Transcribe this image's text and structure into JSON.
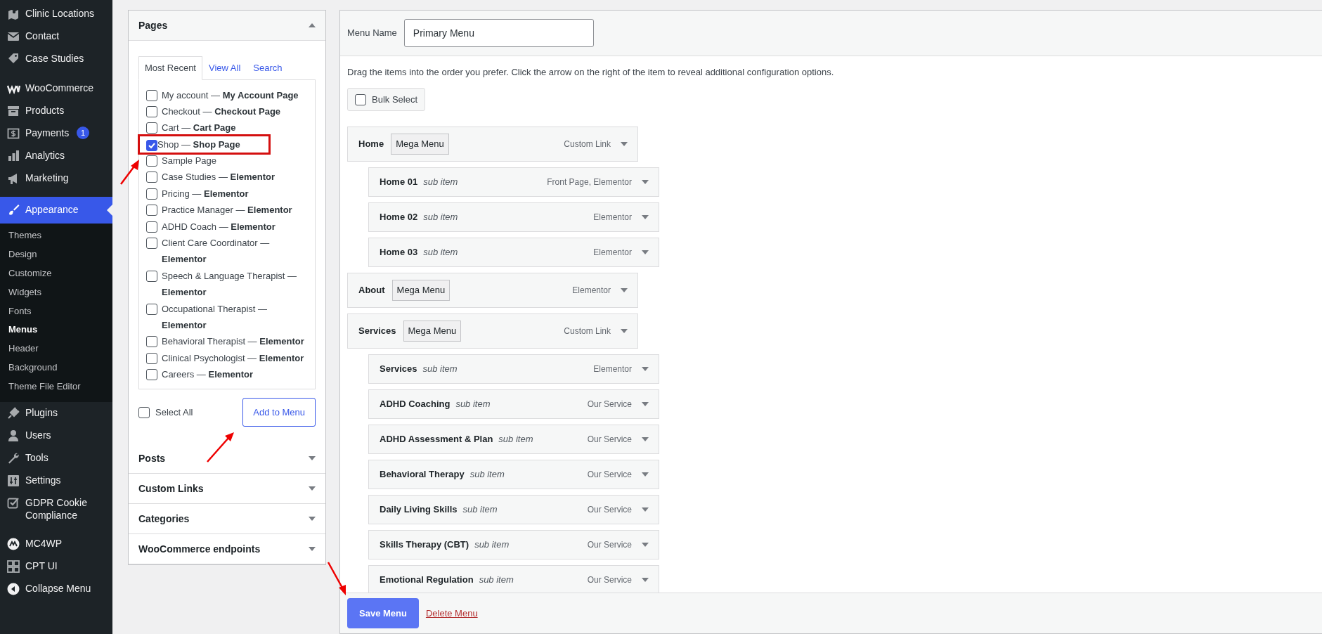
{
  "sidebar": {
    "groups": [
      [
        {
          "label": "Clinic Locations",
          "selected": false
        },
        {
          "label": "Contact",
          "selected": false
        },
        {
          "label": "Case Studies",
          "selected": false
        }
      ],
      [
        {
          "label": "WooCommerce",
          "selected": false
        },
        {
          "label": "Products",
          "selected": false
        },
        {
          "label": "Payments",
          "selected": false,
          "badge": "1"
        },
        {
          "label": "Analytics",
          "selected": false
        },
        {
          "label": "Marketing",
          "selected": false
        }
      ],
      [
        {
          "label": "Appearance",
          "selected": true,
          "expanded": true,
          "children": [
            {
              "label": "Themes",
              "selected": false
            },
            {
              "label": "Design",
              "selected": false
            },
            {
              "label": "Customize",
              "selected": false
            },
            {
              "label": "Widgets",
              "selected": false
            },
            {
              "label": "Fonts",
              "selected": false
            },
            {
              "label": "Menus",
              "selected": true
            },
            {
              "label": "Header",
              "selected": false
            },
            {
              "label": "Background",
              "selected": false
            },
            {
              "label": "Theme File Editor",
              "selected": false
            }
          ]
        },
        {
          "label": "Plugins",
          "selected": false
        },
        {
          "label": "Users",
          "selected": false
        },
        {
          "label": "Tools",
          "selected": false
        },
        {
          "label": "Settings",
          "selected": false
        },
        {
          "label": "GDPR Cookie Compliance",
          "selected": false
        }
      ],
      [
        {
          "label": "MC4WP",
          "selected": false
        },
        {
          "label": "CPT UI",
          "selected": false
        },
        {
          "label": "Collapse Menu",
          "selected": false
        }
      ]
    ]
  },
  "pages_panel": {
    "title": "Pages",
    "expanded": true,
    "tabs": [
      {
        "label": "Most Recent",
        "selected": true
      },
      {
        "label": "View All",
        "selected": false
      },
      {
        "label": "Search",
        "selected": false
      }
    ],
    "items": [
      {
        "label": "My account — **My Account Page**",
        "checked": false,
        "highlighted": false
      },
      {
        "label": "Checkout — **Checkout Page**",
        "checked": false,
        "highlighted": false
      },
      {
        "label": "Cart — **Cart Page**",
        "checked": false,
        "highlighted": false
      },
      {
        "label": "Shop — **Shop Page**",
        "checked": true,
        "highlighted": true
      },
      {
        "label": "Sample Page",
        "checked": false,
        "highlighted": false
      },
      {
        "label": "Case Studies — **Elementor**",
        "checked": false,
        "highlighted": false
      },
      {
        "label": "Pricing — **Elementor**",
        "checked": false,
        "highlighted": false
      },
      {
        "label": "Practice Manager — **Elementor**",
        "checked": false,
        "highlighted": false
      },
      {
        "label": "ADHD Coach — **Elementor**",
        "checked": false,
        "highlighted": false
      },
      {
        "label": "Client Care Coordinator — **Elementor**",
        "checked": false,
        "highlighted": false
      },
      {
        "label": "Speech & Language Therapist — **Elementor**",
        "checked": false,
        "highlighted": false
      },
      {
        "label": "Occupational Therapist — **Elementor**",
        "checked": false,
        "highlighted": false
      },
      {
        "label": "Behavioral Therapist — **Elementor**",
        "checked": false,
        "highlighted": false
      },
      {
        "label": "Clinical Psychologist — **Elementor**",
        "checked": false,
        "highlighted": false
      },
      {
        "label": "Careers — **Elementor**",
        "checked": false,
        "highlighted": false
      }
    ],
    "select_all": {
      "label": "Select All",
      "checked": false
    },
    "add_button": "Add to Menu"
  },
  "other_panels": [
    {
      "title": "Posts",
      "expanded": false
    },
    {
      "title": "Custom Links",
      "expanded": false
    },
    {
      "title": "Categories",
      "expanded": false
    },
    {
      "title": "WooCommerce endpoints",
      "expanded": false
    }
  ],
  "menu_editor": {
    "name_label": "Menu Name",
    "name_value": "Primary Menu",
    "instructions": "Drag the items into the order you prefer. Click the arrow on the right of the item to reveal additional configuration options.",
    "bulk_select": {
      "label": "Bulk Select",
      "checked": false
    },
    "items": [
      {
        "title": "Home",
        "tag": "Mega Menu",
        "type": "Custom Link",
        "children": [
          {
            "title": "Home 01",
            "note": "sub item",
            "type": "Front Page, Elementor"
          },
          {
            "title": "Home 02",
            "note": "sub item",
            "type": "Elementor"
          },
          {
            "title": "Home 03",
            "note": "sub item",
            "type": "Elementor"
          }
        ]
      },
      {
        "title": "About",
        "tag": "Mega Menu",
        "type": "Elementor"
      },
      {
        "title": "Services",
        "tag": "Mega Menu",
        "type": "Custom Link",
        "children": [
          {
            "title": "Services",
            "note": "sub item",
            "type": "Elementor"
          },
          {
            "title": "ADHD Coaching",
            "note": "sub item",
            "type": "Our Service"
          },
          {
            "title": "ADHD Assessment & Plan",
            "note": "sub item",
            "type": "Our Service"
          },
          {
            "title": "Behavioral Therapy",
            "note": "sub item",
            "type": "Our Service"
          },
          {
            "title": "Daily Living Skills",
            "note": "sub item",
            "type": "Our Service"
          },
          {
            "title": "Skills Therapy (CBT)",
            "note": "sub item",
            "type": "Our Service"
          },
          {
            "title": "Emotional Regulation",
            "note": "sub item",
            "type": "Our Service"
          }
        ]
      }
    ],
    "save_button": "Save Menu",
    "delete_link": "Delete Menu"
  }
}
